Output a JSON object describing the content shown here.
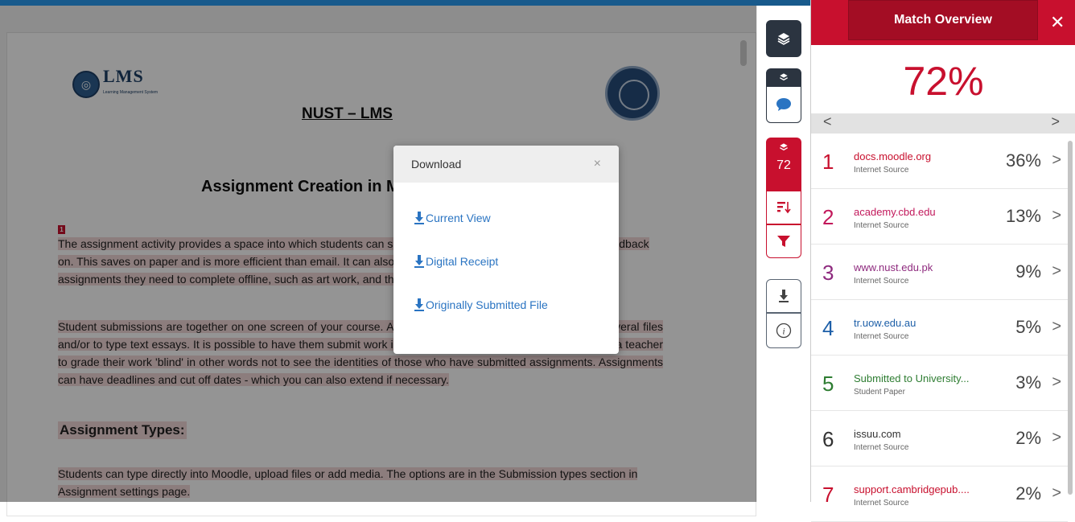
{
  "document": {
    "logo_text": "LMS",
    "logo_subtext": "Learning Management System",
    "title": "NUST – LMS",
    "heading": "Assignment Creation in Moodle",
    "marker_1": "1",
    "para1": "The assignment activity provides a space into which students can submit work for teachers to grade and give feedback on. This saves on paper and is more efficient than email. It can also be used to remind students of 'real-world' assignments they need to complete offline, such as art work, and thus not require any digital content.",
    "para2": "Student submissions are together on one screen of your course. Assignments can allow students to upload several files and/or to type text essays. It is possible to have them submit work in groups and also possible if you choose as a teacher to grade their work 'blind' in other words not to see the identities of those who have submitted assignments. Assignments can have deadlines and cut off dates - which you can also extend if necessary.",
    "sub_heading": "Assignment Types:",
    "para3": "Students can type directly into Moodle, upload files or add media. The options are in the Submission types section in Assignment settings page."
  },
  "dialog": {
    "title": "Download",
    "close": "×",
    "links": [
      "Current View",
      "Digital Receipt",
      "Originally Submitted File"
    ]
  },
  "toolbar": {
    "match_count": "72"
  },
  "panel": {
    "title": "Match Overview",
    "close": "✕",
    "overall": "72%",
    "pager_prev": "<",
    "pager_next": ">",
    "matches": [
      {
        "rank": "1",
        "name": "docs.moodle.org",
        "type": "Internet Source",
        "pct": "36%",
        "color": "#c8102e"
      },
      {
        "rank": "2",
        "name": "academy.cbd.edu",
        "type": "Internet Source",
        "pct": "13%",
        "color": "#c2185b"
      },
      {
        "rank": "3",
        "name": "www.nust.edu.pk",
        "type": "Internet Source",
        "pct": "9%",
        "color": "#8e2a7e"
      },
      {
        "rank": "4",
        "name": "tr.uow.edu.au",
        "type": "Internet Source",
        "pct": "5%",
        "color": "#1d5fa8"
      },
      {
        "rank": "5",
        "name": "Submitted to University...",
        "type": "Student Paper",
        "pct": "3%",
        "color": "#2e7d32"
      },
      {
        "rank": "6",
        "name": "issuu.com",
        "type": "Internet Source",
        "pct": "2%",
        "color": "#333333"
      },
      {
        "rank": "7",
        "name": "support.cambridgepub....",
        "type": "Internet Source",
        "pct": "2%",
        "color": "#c8102e"
      }
    ]
  },
  "colors": {
    "brand_red": "#c8102e",
    "link_blue": "#2a74c2",
    "highlight": "#f2d7d7"
  }
}
